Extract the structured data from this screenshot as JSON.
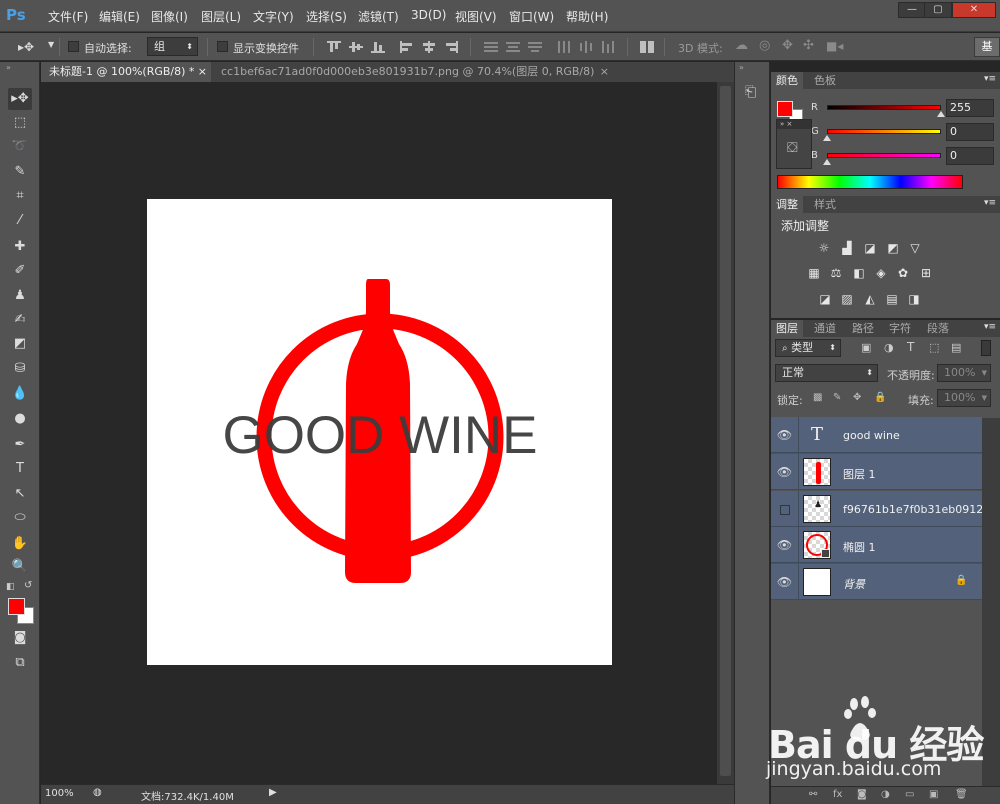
{
  "app": {
    "logo": "Ps",
    "menu": [
      "文件(F)",
      "编辑(E)",
      "图像(I)",
      "图层(L)",
      "文字(Y)",
      "选择(S)",
      "滤镜(T)",
      "3D(D)",
      "视图(V)",
      "窗口(W)",
      "帮助(H)"
    ],
    "window_controls": [
      "—",
      "▢",
      "✕"
    ]
  },
  "options_bar": {
    "auto_select_label": "自动选择:",
    "auto_select_value": "组",
    "show_transform_label": "显示变换控件",
    "mode_3d_label": "3D 模式:",
    "workspace_button": "基"
  },
  "tabs": [
    {
      "label": "未标题-1 @ 100%(RGB/8) *",
      "close": "×"
    },
    {
      "label": "cc1bef6ac71ad0f0d000eb3e801931b7.png @ 70.4%(图层 0, RGB/8)",
      "close": "×"
    }
  ],
  "canvas": {
    "artwork_text": "GOOD WINE",
    "colors": {
      "primary": "#ff0000",
      "text": "#3c3c3c",
      "document_bg": "#ffffff"
    }
  },
  "status": {
    "zoom": "100%",
    "doc_info": "文档:732.4K/1.40M"
  },
  "color_panel": {
    "tabs": [
      "颜色",
      "色板"
    ],
    "sliders": [
      {
        "channel": "R",
        "value": "255"
      },
      {
        "channel": "G",
        "value": "0"
      },
      {
        "channel": "B",
        "value": "0"
      }
    ]
  },
  "adjust_panel": {
    "tabs": [
      "调整",
      "样式"
    ],
    "heading": "添加调整",
    "icon_rows": [
      [
        "brightness-icon",
        "levels-icon",
        "curves-icon",
        "exposure-icon",
        "vibrance-icon"
      ],
      [
        "hue-saturation-icon",
        "color-balance-icon",
        "black-white-icon",
        "photo-filter-icon",
        "channel-mixer-icon",
        "color-lookup-icon"
      ],
      [
        "invert-icon",
        "posterize-icon",
        "threshold-icon",
        "gradient-map-icon",
        "selective-color-icon"
      ]
    ]
  },
  "layers_panel": {
    "tabs": [
      "图层",
      "通道",
      "路径",
      "字符",
      "段落"
    ],
    "filter_type": "类型",
    "blend_mode": "正常",
    "opacity_label": "不透明度:",
    "opacity_value": "100%",
    "lock_label": "锁定:",
    "fill_label": "填充:",
    "fill_value": "100%",
    "layers": [
      {
        "name": "good wine",
        "visible": true,
        "kind": "text"
      },
      {
        "name": "图层 1",
        "visible": true,
        "kind": "bottle"
      },
      {
        "name": "f96761b1e7f0b31eb0912...",
        "visible": false,
        "kind": "smart"
      },
      {
        "name": "椭圆 1",
        "visible": true,
        "kind": "ellipse"
      },
      {
        "name": "背景",
        "visible": true,
        "kind": "background",
        "locked": true
      }
    ]
  },
  "watermark": {
    "brand": "Bai du 经验",
    "url": "jingyan.baidu.com"
  }
}
